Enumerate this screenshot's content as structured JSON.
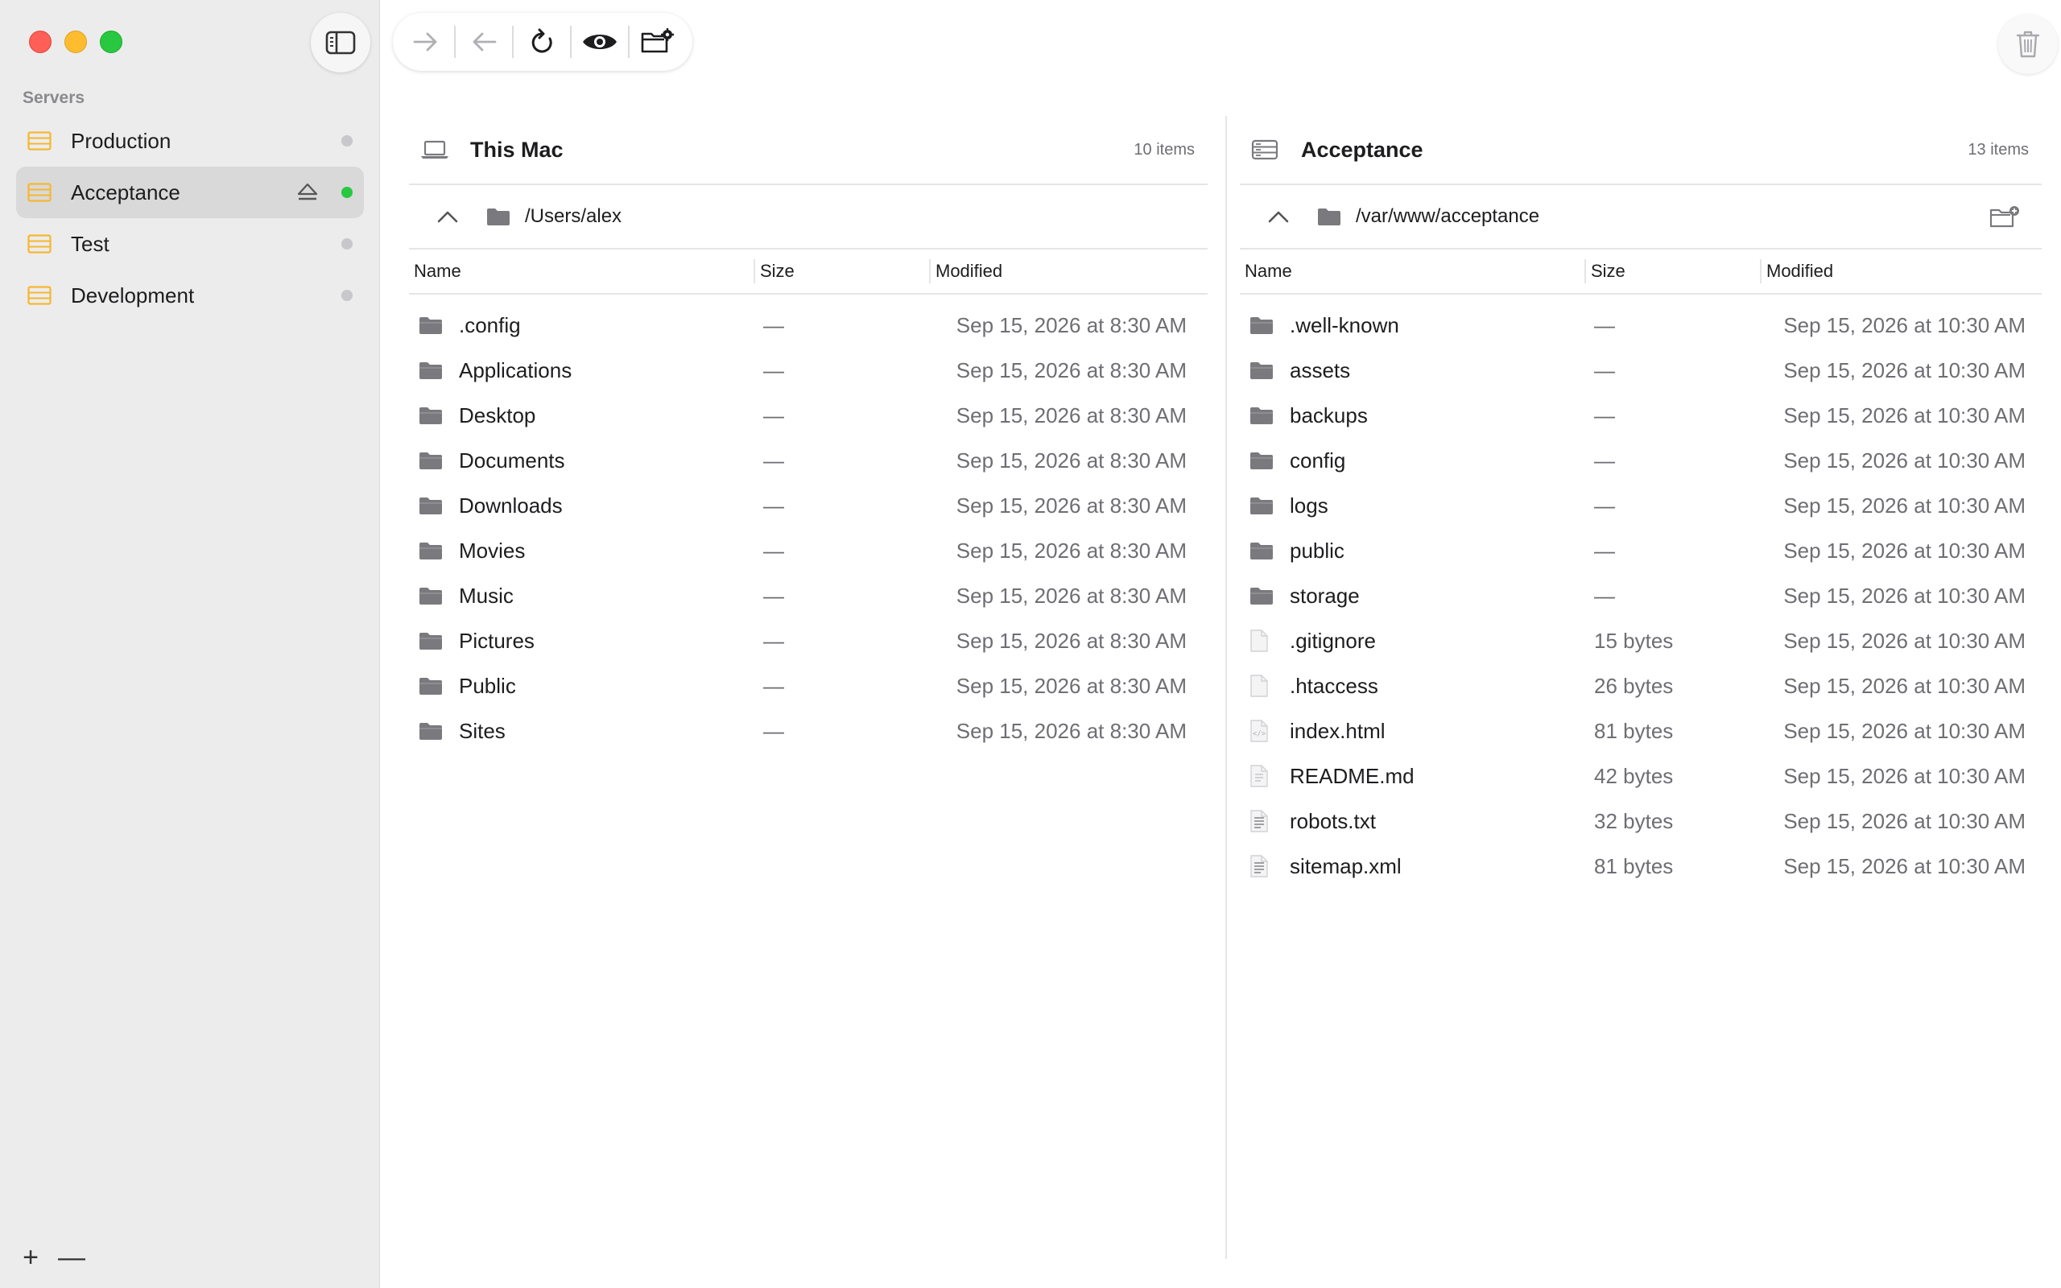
{
  "sidebar": {
    "section_label": "Servers",
    "items": [
      {
        "label": "Production",
        "selected": false,
        "status": "offline"
      },
      {
        "label": "Acceptance",
        "selected": true,
        "status": "online"
      },
      {
        "label": "Test",
        "selected": false,
        "status": "offline"
      },
      {
        "label": "Development",
        "selected": false,
        "status": "offline"
      }
    ],
    "add_label": "+",
    "remove_label": "—"
  },
  "left_pane": {
    "title": "This Mac",
    "count": "10 items",
    "path": "/Users/alex",
    "columns": {
      "name": "Name",
      "size": "Size",
      "modified": "Modified"
    },
    "rows": [
      {
        "name": ".config",
        "size": "—",
        "modified": "Sep 15, 2026 at 8:30 AM",
        "kind": "folder"
      },
      {
        "name": "Applications",
        "size": "—",
        "modified": "Sep 15, 2026 at 8:30 AM",
        "kind": "folder"
      },
      {
        "name": "Desktop",
        "size": "—",
        "modified": "Sep 15, 2026 at 8:30 AM",
        "kind": "folder"
      },
      {
        "name": "Documents",
        "size": "—",
        "modified": "Sep 15, 2026 at 8:30 AM",
        "kind": "folder"
      },
      {
        "name": "Downloads",
        "size": "—",
        "modified": "Sep 15, 2026 at 8:30 AM",
        "kind": "folder"
      },
      {
        "name": "Movies",
        "size": "—",
        "modified": "Sep 15, 2026 at 8:30 AM",
        "kind": "folder"
      },
      {
        "name": "Music",
        "size": "—",
        "modified": "Sep 15, 2026 at 8:30 AM",
        "kind": "folder"
      },
      {
        "name": "Pictures",
        "size": "—",
        "modified": "Sep 15, 2026 at 8:30 AM",
        "kind": "folder"
      },
      {
        "name": "Public",
        "size": "—",
        "modified": "Sep 15, 2026 at 8:30 AM",
        "kind": "folder"
      },
      {
        "name": "Sites",
        "size": "—",
        "modified": "Sep 15, 2026 at 8:30 AM",
        "kind": "folder"
      }
    ]
  },
  "right_pane": {
    "title": "Acceptance",
    "count": "13 items",
    "path": "/var/www/acceptance",
    "columns": {
      "name": "Name",
      "size": "Size",
      "modified": "Modified"
    },
    "rows": [
      {
        "name": ".well-known",
        "size": "—",
        "modified": "Sep 15, 2026 at 10:30 AM",
        "kind": "folder"
      },
      {
        "name": "assets",
        "size": "—",
        "modified": "Sep 15, 2026 at 10:30 AM",
        "kind": "folder"
      },
      {
        "name": "backups",
        "size": "—",
        "modified": "Sep 15, 2026 at 10:30 AM",
        "kind": "folder"
      },
      {
        "name": "config",
        "size": "—",
        "modified": "Sep 15, 2026 at 10:30 AM",
        "kind": "folder"
      },
      {
        "name": "logs",
        "size": "—",
        "modified": "Sep 15, 2026 at 10:30 AM",
        "kind": "folder"
      },
      {
        "name": "public",
        "size": "—",
        "modified": "Sep 15, 2026 at 10:30 AM",
        "kind": "folder"
      },
      {
        "name": "storage",
        "size": "—",
        "modified": "Sep 15, 2026 at 10:30 AM",
        "kind": "folder"
      },
      {
        "name": ".gitignore",
        "size": "15 bytes",
        "modified": "Sep 15, 2026 at 10:30 AM",
        "kind": "file"
      },
      {
        "name": ".htaccess",
        "size": "26 bytes",
        "modified": "Sep 15, 2026 at 10:30 AM",
        "kind": "file"
      },
      {
        "name": "index.html",
        "size": "81 bytes",
        "modified": "Sep 15, 2026 at 10:30 AM",
        "kind": "file-code"
      },
      {
        "name": "README.md",
        "size": "42 bytes",
        "modified": "Sep 15, 2026 at 10:30 AM",
        "kind": "file-text"
      },
      {
        "name": "robots.txt",
        "size": "32 bytes",
        "modified": "Sep 15, 2026 at 10:30 AM",
        "kind": "file-lines"
      },
      {
        "name": "sitemap.xml",
        "size": "81 bytes",
        "modified": "Sep 15, 2026 at 10:30 AM",
        "kind": "file-lines"
      }
    ]
  },
  "colors": {
    "server_icon": "#f5b731",
    "folder": "#7a7a7e",
    "online": "#28c840",
    "offline": "#c7c7cc",
    "selected_bg": "#d9d9d9"
  },
  "icons": {
    "toolbar": [
      "arrow-right-icon",
      "arrow-left-icon",
      "refresh-icon",
      "eye-icon",
      "folder-gear-icon"
    ],
    "trash": "trash-icon"
  }
}
